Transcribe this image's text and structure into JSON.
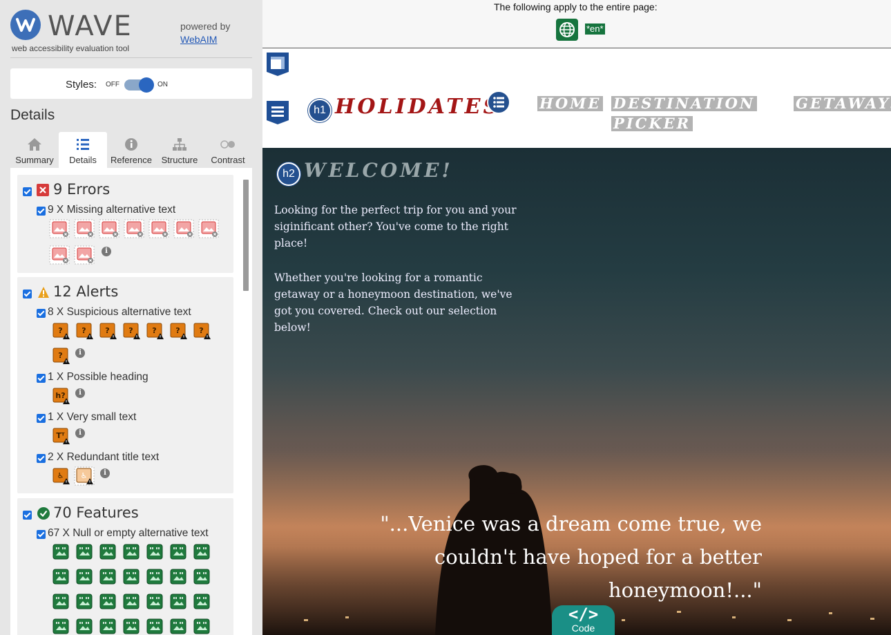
{
  "wave": {
    "logo_text": "WAVE",
    "subtitle": "web accessibility evaluation tool",
    "powered_by": "powered by",
    "webaim_link": "WebAIM",
    "styles_label": "Styles:",
    "toggle_off": "OFF",
    "toggle_on": "ON",
    "styles_on": true,
    "details_heading": "Details",
    "tabs": [
      {
        "label": "Summary",
        "icon": "home-icon"
      },
      {
        "label": "Details",
        "icon": "list-icon",
        "active": true
      },
      {
        "label": "Reference",
        "icon": "info-icon"
      },
      {
        "label": "Structure",
        "icon": "sitemap-icon"
      },
      {
        "label": "Contrast",
        "icon": "contrast-icon"
      }
    ],
    "errors": {
      "title": "9 Errors",
      "items": [
        {
          "label": "9 X Missing alternative text",
          "count": 9
        }
      ]
    },
    "alerts": {
      "title": "12 Alerts",
      "items": [
        {
          "label": "8 X Suspicious alternative text",
          "count": 8
        },
        {
          "label": "1 X Possible heading",
          "count": 1,
          "badge": "h?"
        },
        {
          "label": "1 X Very small text",
          "count": 1,
          "badge": "Tᵀ"
        },
        {
          "label": "2 X Redundant title text",
          "count": 2
        }
      ]
    },
    "features": {
      "title": "70 Features",
      "items": [
        {
          "label": "67 X Null or empty alternative text",
          "count": 67
        }
      ]
    },
    "colors": {
      "error": "#d63b3b",
      "alert": "#e07b12",
      "feature": "#1f7a3d",
      "checkbox": "#1a6fe0"
    }
  },
  "page": {
    "apply_text": "The following apply to the entire page:",
    "lang_badge": "*en*",
    "brand": "HOLIDATES",
    "h1_badge": "h1",
    "h2_badge": "h2",
    "nav": [
      "HOME",
      "DESTINATION",
      "PICKER",
      "GETAWAYS"
    ],
    "welcome": "WELCOME!",
    "para1": "Looking for the perfect trip for you and your siginificant other? You've come to the right place!",
    "para2": "Whether you're looking for a romantic getaway or a honeymoon destination, we've got you covered. Check out our selection below!",
    "quote": "\"...Venice was a dream come true, we couldn't have hoped for a better honeymoon!...\"",
    "code_glyph": "</>",
    "code_label": "Code"
  }
}
